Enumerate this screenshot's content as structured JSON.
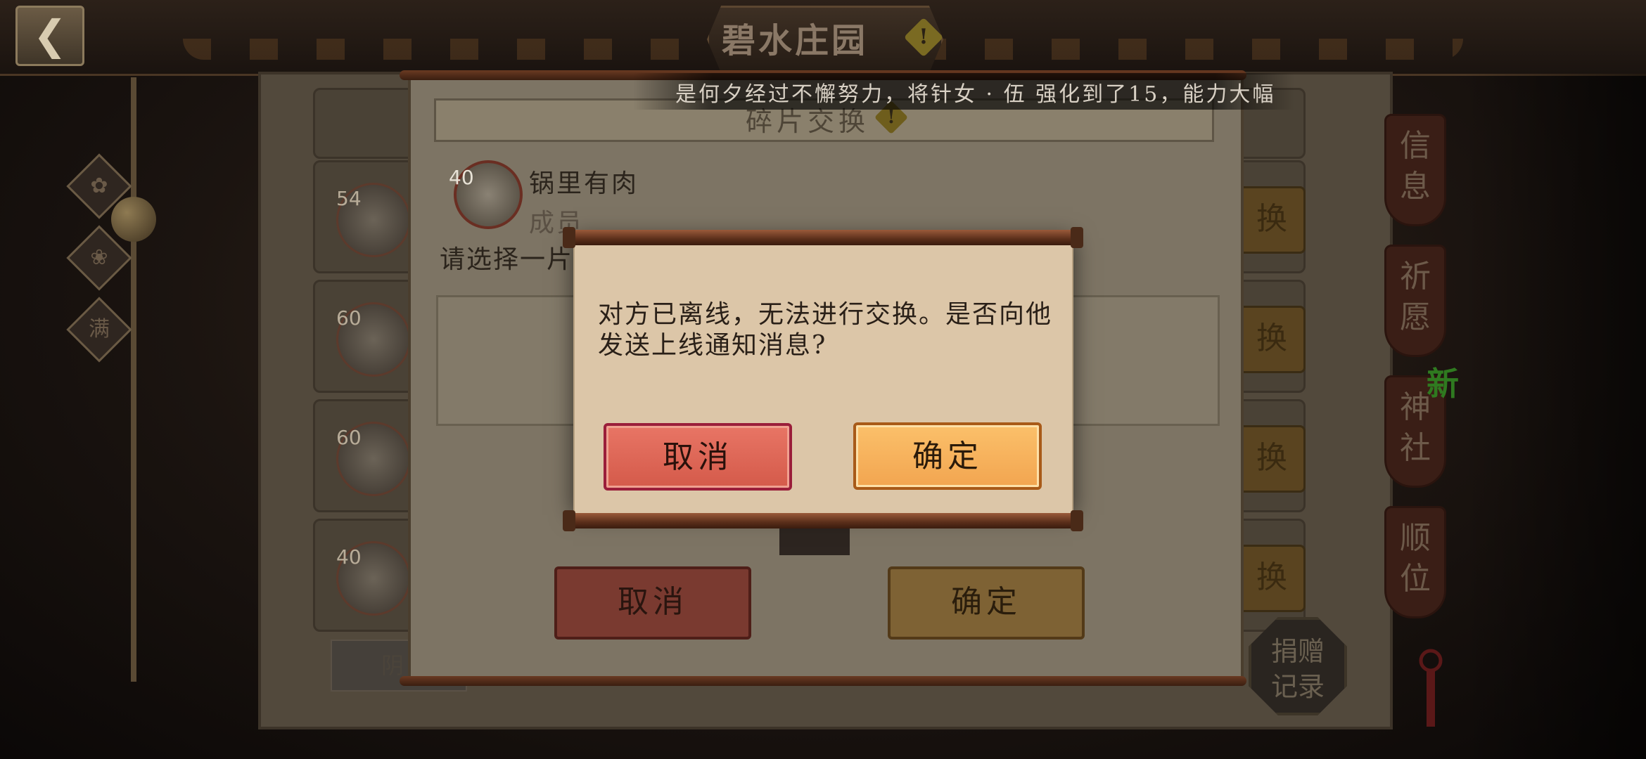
{
  "header": {
    "title": "碧水庄园",
    "alert_glyph": "!"
  },
  "marquee": {
    "text": "是何夕经过不懈努力，将针女 · 伍 强化到了15，能力大幅"
  },
  "left_rail": {
    "tags": [
      "✿",
      "❀",
      "满"
    ]
  },
  "list": {
    "levels": [
      "54",
      "60",
      "60",
      "40"
    ],
    "exchange_label": "换"
  },
  "side_tabs": [
    {
      "label": "信\n息"
    },
    {
      "label": "祈\n愿"
    },
    {
      "label": "神\n社"
    },
    {
      "label": "顺\n位"
    }
  ],
  "new_badge": "新",
  "donate_record": "捐赠\n记录",
  "bottom_field": "阴",
  "panel": {
    "section_title": "碎片交换",
    "user": {
      "level": "40",
      "name": "锅里有肉",
      "role": "成员"
    },
    "select_prompt": "请选择一片",
    "cancel_label": "取消",
    "confirm_label": "确定"
  },
  "modal": {
    "message": "对方已离线，无法进行交换。是否向他发送上线通知消息?",
    "cancel_label": "取消",
    "confirm_label": "确定"
  },
  "colors": {
    "modal_bg": "#dcc6a8",
    "cancel_red": "#e06a5a",
    "confirm_orange": "#f6b25c"
  }
}
